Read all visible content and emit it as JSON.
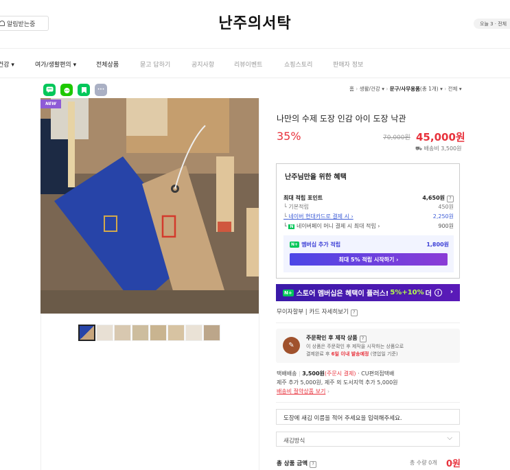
{
  "header": {
    "notify_label": "알림받는중",
    "store_title": "난주의서탁",
    "today_label": "오늘 3 · 전체"
  },
  "nav": {
    "items": [
      "건강",
      "여가/생활편의",
      "전체상품",
      "묻고 답하기",
      "공지사항",
      "리뷰이벤트",
      "쇼핑스토리",
      "판매자 정보"
    ]
  },
  "share": {
    "icons": [
      "talk-icon",
      "band-icon",
      "bookmark-icon",
      "more-icon"
    ]
  },
  "breadcrumb": {
    "home": "홈",
    "cat1": "생활/건강",
    "cat2": "문구/사무용품",
    "count": "(총 1개)",
    "all": "전체"
  },
  "image": {
    "badge": "NEW",
    "thumb_count": 8
  },
  "product": {
    "title": "나만의 수제 도장 인감 아이 도장 낙관",
    "discount": "35%",
    "original_price": "70,000원",
    "sale_price": "45,000원",
    "shipping": "배송비 3,500원"
  },
  "benefit": {
    "title": "난주님만을 위한 혜택",
    "max_points_label": "최대 적립 포인트",
    "max_points_value": "4,650원",
    "basic_label": "기본적립",
    "basic_value": "450원",
    "card_label": "네이버 현대카드로 결제 시",
    "card_value": "2,250원",
    "npay_label": "네이버페이 머니 결제 시 최대 적립",
    "npay_value": "900원",
    "member_label": "멤버십 추가 적립",
    "member_value": "1,800원",
    "member_button": "최대 5% 적립 시작하기"
  },
  "plus_banner": {
    "prefix": "스토어 멤버십은 혜택이 플러스!",
    "highlight": "5%+10%",
    "suffix": "더"
  },
  "interest_free": "무이자할부 | 카드 자세히보기",
  "made_to_order": {
    "title": "주문확인 후 제작 상품",
    "desc1": "이 상품은 주문확인 후 제작을 시작하는 상품으로",
    "desc2_prefix": "결제완료 후",
    "desc2_red": "6일 이내 발송예정",
    "desc2_suffix": "(영업일 기준)"
  },
  "delivery": {
    "label": "택배배송",
    "fee": "3,500원",
    "fee_note": "(주문시 결제)",
    "carrier": "· CU편의점택배",
    "jeju": "제주 추가 5,000원, 제주 외 도서지역 추가 5,000원",
    "link": "배송비 절약상품 보기"
  },
  "options": {
    "engrave_prompt": "도장에 새김 이름을 적어 주세요을 입력해주세요.",
    "engrave_method": "새김방식"
  },
  "total": {
    "label": "총 상품 금액",
    "qty": "총 수량 0개",
    "value": "0원"
  },
  "colors": {
    "accent_red": "#e8323c",
    "naver_green": "#03c75a",
    "member_blue": "#3b3ed6"
  }
}
